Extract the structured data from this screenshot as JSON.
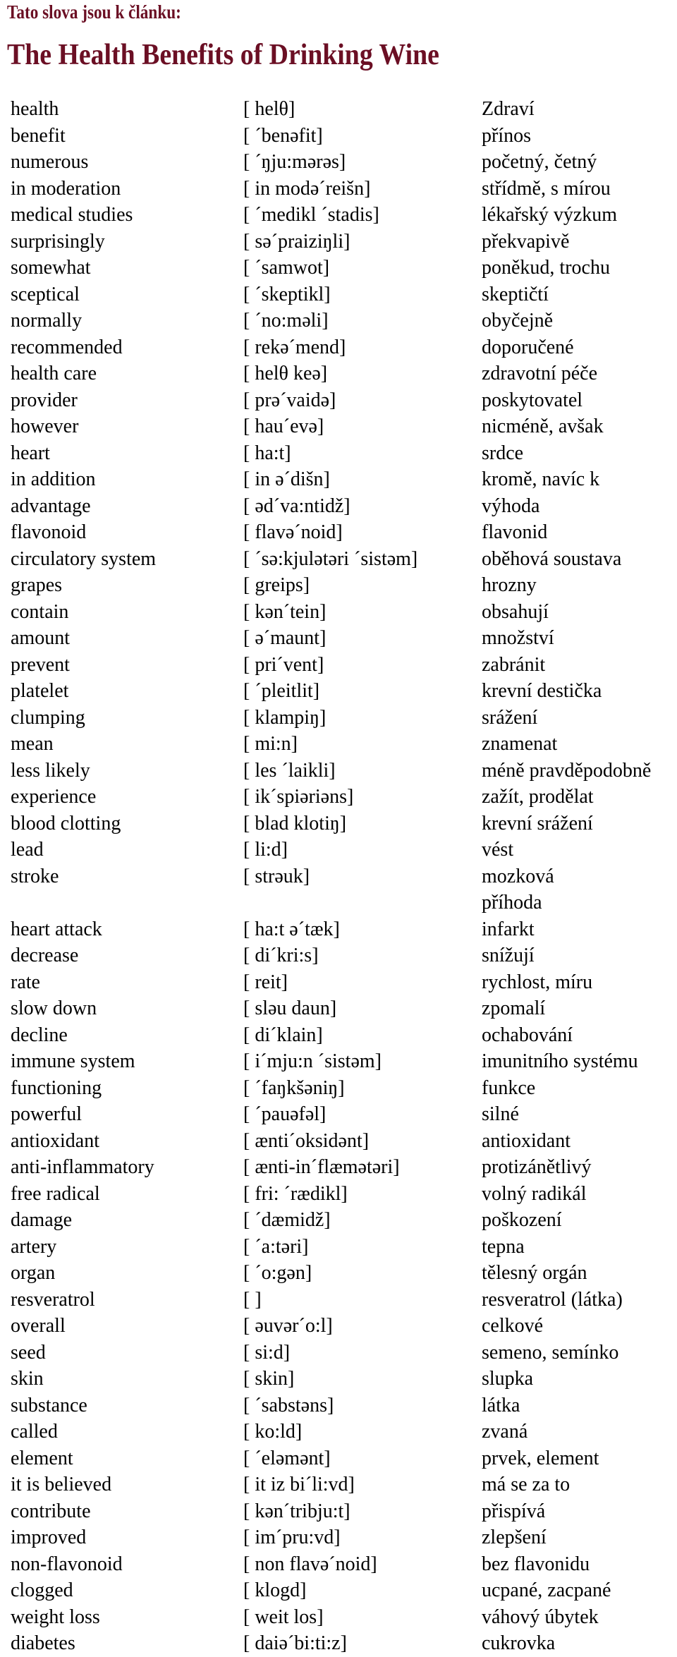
{
  "header": {
    "intro": "Tato slova jsou k článku:",
    "title": "The Health Benefits of Drinking Wine",
    "color": "#6b0f24"
  },
  "vocabulary": [
    [
      "health",
      "[ helθ]",
      "Zdraví"
    ],
    [
      "benefit",
      "[ ´benəfit]",
      "přínos"
    ],
    [
      "numerous",
      "[ ´ŋju:mərəs]",
      "početný, četný"
    ],
    [
      "in moderation",
      "[ in modə´reišn]",
      "střídmě, s mírou"
    ],
    [
      "medical studies",
      "[ ´medikl ´stadis]",
      "lékařský výzkum"
    ],
    [
      "surprisingly",
      "[ sə´praiziŋli]",
      "překvapivě"
    ],
    [
      "somewhat",
      "[ ´samwot]",
      "poněkud, trochu"
    ],
    [
      "sceptical",
      "[ ´skeptikl]",
      "skeptičtí"
    ],
    [
      "normally",
      "[ ´no:məli]",
      "obyčejně"
    ],
    [
      "recommended",
      "[ rekə´mend]",
      "doporučené"
    ],
    [
      "health care",
      "[ helθ keə]",
      "zdravotní péče"
    ],
    [
      "provider",
      "[ prə´vaidə]",
      "poskytovatel"
    ],
    [
      "however",
      "[ hau´evə]",
      "nicméně, avšak"
    ],
    [
      "heart",
      "[ ha:t]",
      "srdce"
    ],
    [
      "in addition",
      "[ in ə´dišn]",
      "kromě, navíc k"
    ],
    [
      "advantage",
      "[ əd´va:ntidž]",
      "výhoda"
    ],
    [
      "flavonoid",
      "[ flavə´noid]",
      "flavonid"
    ],
    [
      "circulatory system",
      "[ ´sə:kjulətəri ´sistəm]",
      "oběhová soustava"
    ],
    [
      "grapes",
      "[ greips]",
      "hrozny"
    ],
    [
      "contain",
      "[ kən´tein]",
      "obsahují"
    ],
    [
      "amount",
      "[ ə´maunt]",
      "množství"
    ],
    [
      "prevent",
      "[ pri´vent]",
      "zabránit"
    ],
    [
      "platelet",
      "[ ´pleitlit]",
      "krevní destička"
    ],
    [
      "clumping",
      "[ klampiŋ]",
      "srážení"
    ],
    [
      "mean",
      "[ mi:n]",
      "znamenat"
    ],
    [
      "less likely",
      "[ les ´laikli]",
      "méně pravděpodobně"
    ],
    [
      "experience",
      "[ ik´spiəriəns]",
      "zažít, prodělat"
    ],
    [
      "blood clotting",
      "[ blad klotiŋ]",
      "krevní srážení"
    ],
    [
      "lead",
      "[ li:d]",
      "vést"
    ],
    [
      "stroke",
      "[ strəuk]",
      "mozková příhoda"
    ],
    [
      "heart attack",
      "[ ha:t ə´tæk]",
      "infarkt"
    ],
    [
      "decrease",
      "[ di´kri:s]",
      "snížují"
    ],
    [
      "rate",
      "[ reit]",
      "rychlost, míru"
    ],
    [
      "slow down",
      "[ sləu daun]",
      "zpomalí"
    ],
    [
      "decline",
      "[ di´klain]",
      "ochabování"
    ],
    [
      "immune system",
      "[ i´mju:n ´sistəm]",
      "imunitního systému"
    ],
    [
      "functioning",
      "[ ´faŋkšəniŋ]",
      "funkce"
    ],
    [
      "powerful",
      "[ ´pauəfəl]",
      "silné"
    ],
    [
      "antioxidant",
      "[ ænti´oksidənt]",
      "antioxidant"
    ],
    [
      "anti-inflammatory",
      "[ ænti-in´flæmətəri]",
      "protizánětlivý"
    ],
    [
      "free radical",
      "[ fri: ´rædikl]",
      "volný radikál"
    ],
    [
      "damage",
      "[ ´dæmidž]",
      "poškození"
    ],
    [
      "artery",
      "[ ´a:təri]",
      "tepna"
    ],
    [
      "organ",
      "[ ´o:gən]",
      "tělesný orgán"
    ],
    [
      "resveratrol",
      "[ ]",
      "resveratrol (látka)"
    ],
    [
      "overall",
      "[ əuvər´o:l]",
      "celkové"
    ],
    [
      "seed",
      "[ si:d]",
      "semeno, semínko"
    ],
    [
      "skin",
      "[ skin]",
      "slupka"
    ],
    [
      "substance",
      "[ ´sabstəns]",
      "látka"
    ],
    [
      "called",
      "[ ko:ld]",
      "zvaná"
    ],
    [
      "element",
      "[ ´eləmənt]",
      "prvek, element"
    ],
    [
      "it is believed",
      "[ it iz bi´li:vd]",
      "má se za to"
    ],
    [
      "contribute",
      "[ kən´tribju:t]",
      "přispívá"
    ],
    [
      "improved",
      "[ im´pru:vd]",
      "zlepšení"
    ],
    [
      "non-flavonoid",
      "[ non flavə´noid]",
      "bez flavonidu"
    ],
    [
      "clogged",
      "[ klogd]",
      "ucpané, zacpané"
    ],
    [
      "weight loss",
      "[ weit los]",
      "váhový úbytek"
    ],
    [
      "diabetes",
      "[ daiə´bi:ti:z]",
      "cukrovka"
    ]
  ]
}
